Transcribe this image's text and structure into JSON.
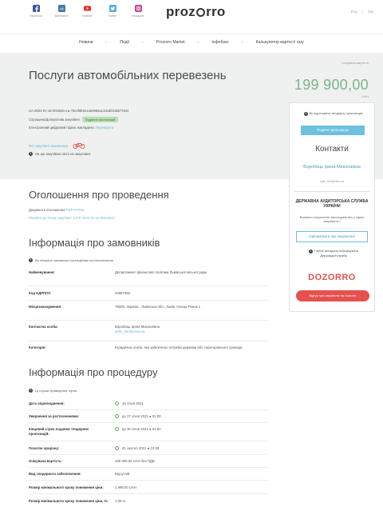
{
  "header": {
    "social": [
      {
        "label": "Facebook",
        "icon": "facebook-icon"
      },
      {
        "label": "Вконтакте",
        "icon": "vk-icon"
      },
      {
        "label": "Youtube",
        "icon": "youtube-icon"
      },
      {
        "label": "Twitter",
        "icon": "twitter-icon"
      },
      {
        "label": "Instagram",
        "icon": "instagram-icon"
      }
    ],
    "logo_left": "proz",
    "logo_right": "rro",
    "lang_en": "Eng",
    "lang_sep": "|",
    "lang_uk": "Укр"
  },
  "nav": {
    "items": [
      "Новини",
      "Події",
      "Prozorro Market",
      "Інфобокс",
      "Калькулятор вартості газу"
    ]
  },
  "tender": {
    "title": "Послуги автомобільних перевезень",
    "budget_label": "очікувана вартість",
    "budget": "199 900,00",
    "currency": "UAH",
    "tender_id": "UA-2021-01-15-004362-a ● 70ecf0b2e1a94965ac10ed0319677644",
    "procedure": "Спрощена/Допорогова закупівля",
    "status": "Подання пропозицій",
    "sign_text": "Електронний цифровий підпис накладено.",
    "sign_link": "Перевірити",
    "all_purchases": "Всі закупівлі замовника",
    "no_complaints": "На цю закупівлю ніхто не звертався"
  },
  "sidebar": {
    "notice": "Як підготувати тендерну пропозицію",
    "offer_button": "Подати пропозицію",
    "contacts_title": "Контакти",
    "person": "Воробець Ірина Миколаївна",
    "email": "upfin_lmr@meta.ua",
    "audit_title": "ДЕРЖАВНА АУДИТОРСЬКА СЛУЖБА УКРАЇНИ",
    "audit_question": "Виявили порушення законодавства у сфері закупівель?",
    "report_button": "Інформувати про порушення",
    "informed": "У мене вигадало інформувати Держаудитслужбу",
    "dozorro": "DOZORRO",
    "review_button": "Відгук про закупівлю на Dozorro"
  },
  "announcement": {
    "title": "Оголошення про проведення",
    "doc_prefix": "Документи оголошення",
    "doc_pdf": "PDF",
    "doc_sep": "•",
    "doc_html": "HTML",
    "plan_link": "Перейти до плану закупівлі: UA-P-2021-01-15-002109-b"
  },
  "customer": {
    "title": "Інформація про замовників",
    "note": "Ви обирали замовника потенційним постачальником",
    "rows": [
      {
        "k": "Найменування:",
        "v": "Департамент фінансової політики Львівської міської ради"
      },
      {
        "k": "Код ЄДРПОУ:",
        "v": "34857384"
      },
      {
        "k": "Місцезнаходження:",
        "v": "79008, Україна , Львівська обл., Львів, площа Ринок,1"
      },
      {
        "k": "Контактна особа:",
        "v": "Воробець Ірина Миколаївна",
        "v2": "upfin_lmr@meta.ua"
      },
      {
        "k": "Категорія:",
        "v": "Юридична особа, яка забезпечує потреби держави або територіальної громади"
      }
    ]
  },
  "procedure_info": {
    "title": "Інформація про процедуру",
    "note": "Ці строки проведення торгів",
    "rows": [
      {
        "k": "Дата оприлюднення:",
        "v": "15 січня 2021"
      },
      {
        "k": "Звернення за роз'ясненнями:",
        "v": "до  27 січня 2021  ● 01:00"
      },
      {
        "k": "Кінцевий строк подання тендерних пропозицій:",
        "v": "до  30 січня 2021  ● 01:00"
      },
      {
        "k": "Початок аукціону:",
        "v": "01 лютого 2021  ● 13:38"
      },
      {
        "k": "Очікувана вартість:",
        "v": "199 900,00 UAH без ПДВ"
      },
      {
        "k": "Вид тендерного забезпечення:",
        "v": "Відсутній"
      },
      {
        "k": "Розмір мінімального кроку пониження ціни:",
        "v": "1 999,00 UAH"
      },
      {
        "k": "Розмір мінімального кроку пониження ціни, %:",
        "v": "1,00 %"
      }
    ]
  }
}
